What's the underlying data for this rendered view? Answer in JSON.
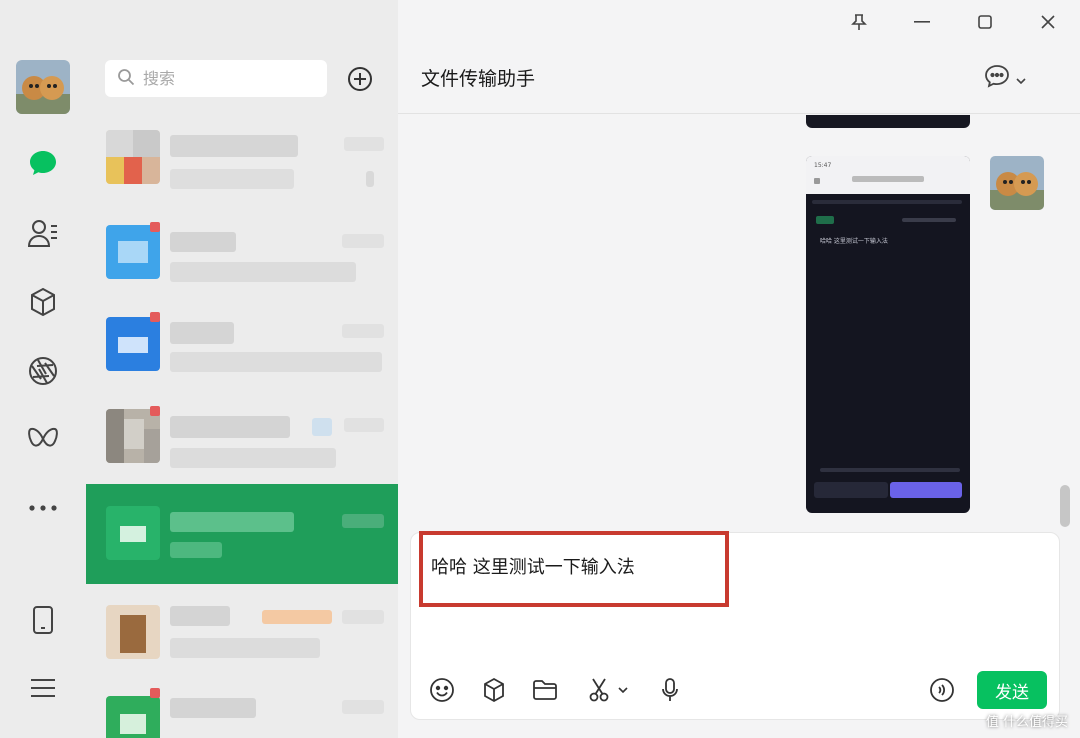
{
  "titlebar": {
    "pin_icon": "pin-icon",
    "minimize_icon": "minimize-icon",
    "maximize_icon": "maximize-icon",
    "close_icon": "close-icon"
  },
  "nav": {
    "items": [
      {
        "name": "chat",
        "icon": "chat-bubble-icon",
        "active": true
      },
      {
        "name": "contacts",
        "icon": "contacts-icon"
      },
      {
        "name": "favorites",
        "icon": "cube-icon"
      },
      {
        "name": "moments",
        "icon": "aperture-icon"
      },
      {
        "name": "channels",
        "icon": "butterfly-icon"
      },
      {
        "name": "more",
        "icon": "ellipsis-icon"
      },
      {
        "name": "phone",
        "icon": "phone-icon"
      },
      {
        "name": "menu",
        "icon": "menu-icon"
      }
    ]
  },
  "search": {
    "placeholder": "搜索"
  },
  "chat": {
    "title": "文件传输助手",
    "input_value": "哈哈 这里测试一下输入法",
    "send_label": "发送"
  },
  "embedded_screenshot": {
    "time": "15:47",
    "message": "哈哈 这里测试一下输入法"
  },
  "watermark": "值 什么值得买",
  "colors": {
    "accent": "#07c160",
    "active_row": "#1f9e5a",
    "highlight_box": "#c83a2f"
  }
}
